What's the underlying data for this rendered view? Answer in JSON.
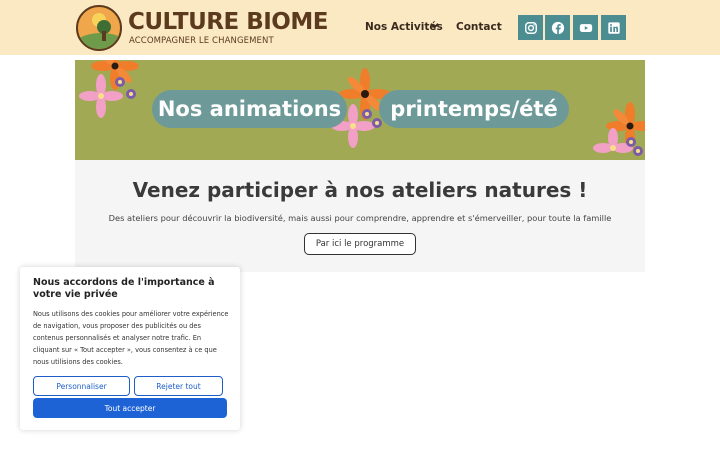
{
  "header": {
    "brand_name": "CULTURE BIOME",
    "brand_tagline": "ACCOMPAGNER LE CHANGEMENT",
    "nav": {
      "activities_label": "Nos Activités",
      "contact_label": "Contact"
    },
    "social_icons": [
      "instagram-icon",
      "facebook-icon",
      "youtube-icon",
      "linkedin-icon"
    ],
    "colors": {
      "header_bg": "#fbe9c4",
      "brand": "#5b3a1e",
      "social_bg": "#4c8d92"
    }
  },
  "banner": {
    "pill_left": "Nos animations",
    "pill_right": "printemps/été",
    "colors": {
      "bg": "#a1a955",
      "pill": "#6d9a98"
    }
  },
  "main": {
    "headline": "Venez participer à nos ateliers natures !",
    "subline": "Des ateliers pour découvrir la biodiversité, mais aussi pour comprendre, apprendre et s'émerveiller, pour toute la famille",
    "program_button": "Par ici le programme"
  },
  "cookie": {
    "title": "Nous accordons de l'importance à votre vie privée",
    "body": "Nous utilisons des cookies pour améliorer votre expérience de navigation, vous proposer des publicités ou des contenus personnalisés et analyser notre trafic. En cliquant sur « Tout accepter », vous consentez à ce que nous utilisions des cookies.",
    "customize_label": "Personnaliser",
    "reject_label": "Rejeter tout",
    "accept_label": "Tout accepter",
    "colors": {
      "primary": "#1e63d6"
    }
  }
}
